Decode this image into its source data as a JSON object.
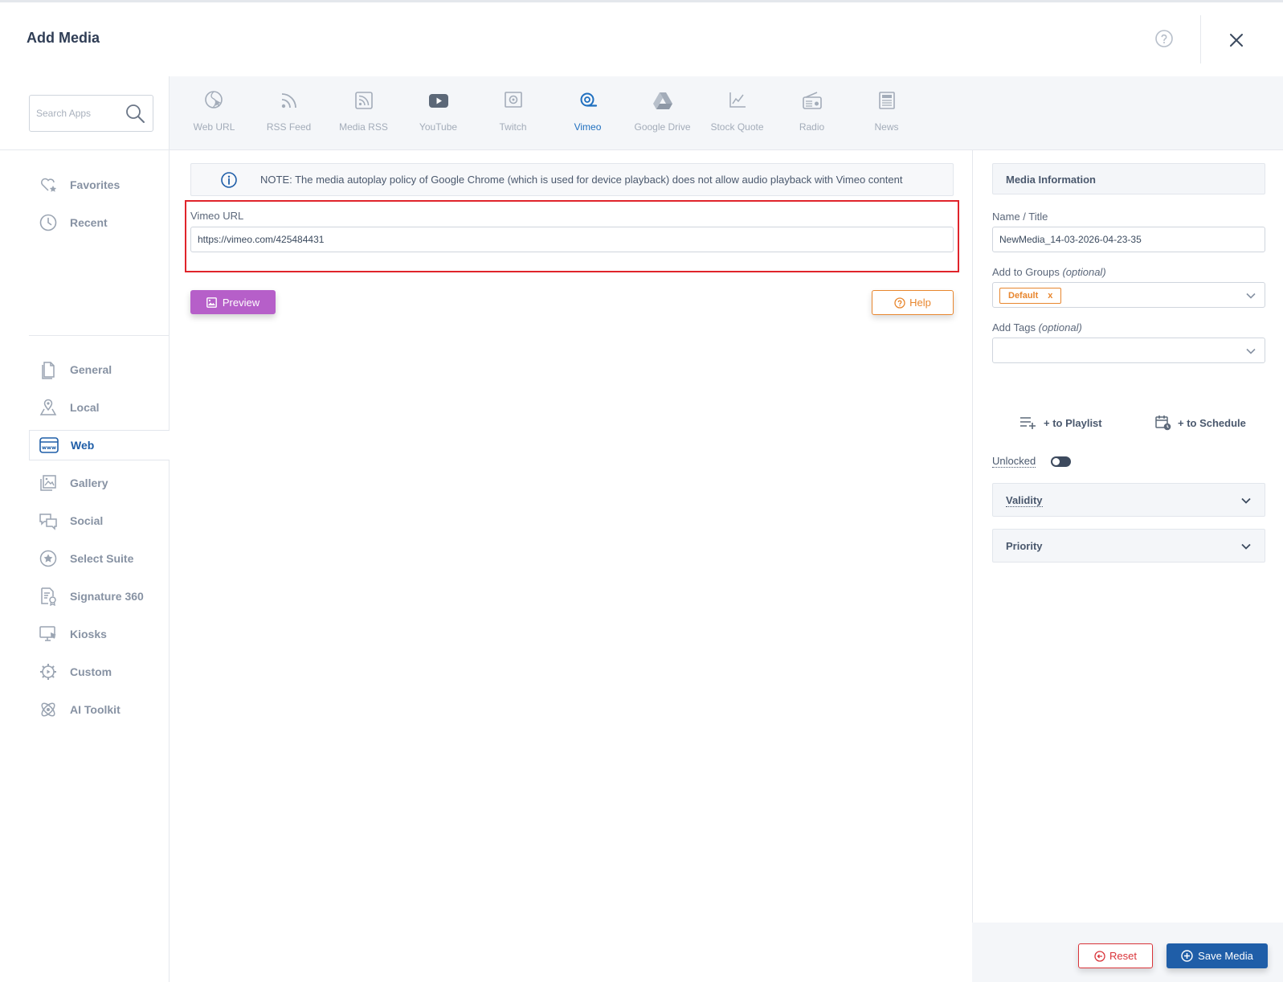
{
  "header": {
    "title": "Add Media"
  },
  "search": {
    "placeholder": "Search Apps"
  },
  "sidebar": {
    "items": [
      {
        "label": "Favorites",
        "icon": "heart-star-icon"
      },
      {
        "label": "Recent",
        "icon": "clock-icon"
      },
      {
        "label": "General",
        "icon": "document-icon"
      },
      {
        "label": "Local",
        "icon": "map-pin-icon"
      },
      {
        "label": "Web",
        "icon": "www-icon",
        "active": true
      },
      {
        "label": "Gallery",
        "icon": "gallery-icon"
      },
      {
        "label": "Social",
        "icon": "chat-bubbles-icon"
      },
      {
        "label": "Select Suite",
        "icon": "star-circle-icon"
      },
      {
        "label": "Signature 360",
        "icon": "signature-doc-icon"
      },
      {
        "label": "Kiosks",
        "icon": "kiosk-monitor-icon"
      },
      {
        "label": "Custom",
        "icon": "gear-play-icon"
      },
      {
        "label": "AI Toolkit",
        "icon": "atom-icon"
      }
    ]
  },
  "tabs": [
    {
      "label": "Web URL",
      "icon": "globe-cursor-icon"
    },
    {
      "label": "RSS Feed",
      "icon": "rss-icon"
    },
    {
      "label": "Media RSS",
      "icon": "media-rss-icon"
    },
    {
      "label": "YouTube",
      "icon": "youtube-icon"
    },
    {
      "label": "Twitch",
      "icon": "twitch-icon"
    },
    {
      "label": "Vimeo",
      "icon": "vimeo-icon",
      "active": true
    },
    {
      "label": "Google Drive",
      "icon": "google-drive-icon"
    },
    {
      "label": "Stock Quote",
      "icon": "line-chart-icon"
    },
    {
      "label": "Radio",
      "icon": "radio-icon"
    },
    {
      "label": "News",
      "icon": "newspaper-icon"
    }
  ],
  "main": {
    "note": "NOTE: The media autoplay policy of Google Chrome (which is used for device playback) does not allow audio playback with Vimeo content",
    "url_label": "Vimeo URL",
    "url_value": "https://vimeo.com/425484431",
    "preview_label": "Preview",
    "help_label": "Help"
  },
  "info": {
    "title": "Media Information",
    "name_label": "Name / Title",
    "name_value": "NewMedia_14-03-2026-04-23-35",
    "groups_label": "Add to Groups",
    "groups_optional": "(optional)",
    "group_chip": "Default",
    "chip_remove": "x",
    "tags_label": "Add Tags",
    "tags_optional": "(optional)",
    "playlist_label": "+ to Playlist",
    "schedule_label": "+ to Schedule",
    "lock_label": "Unlocked",
    "validity_label": "Validity",
    "priority_label": "Priority"
  },
  "footer": {
    "reset_label": "Reset",
    "save_label": "Save Media"
  },
  "colors": {
    "accent_blue": "#1f5ea8",
    "preview_purple": "#b65fc9",
    "help_orange": "#e8862e",
    "reset_red": "#d9343a",
    "highlight_red": "#e0242b"
  }
}
